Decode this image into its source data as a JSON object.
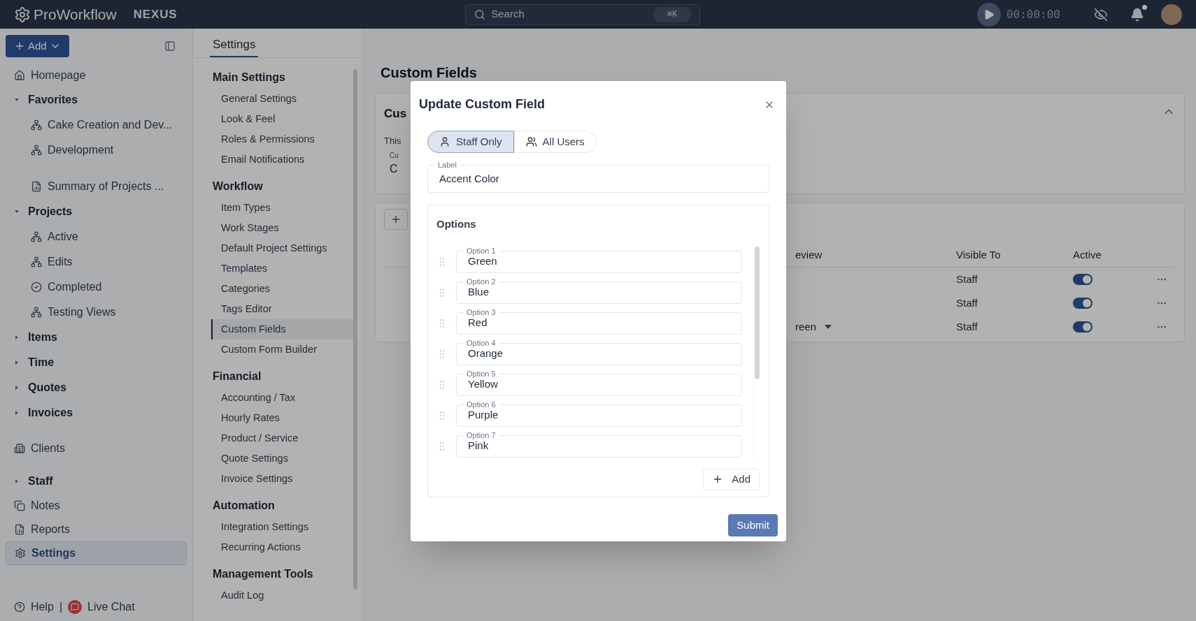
{
  "topbar": {
    "brand": "ProWorkflow",
    "product": "NEXUS",
    "search": {
      "placeholder": "Search",
      "shortcut": "⌘K"
    },
    "timer": "00:00:00"
  },
  "sidebar": {
    "add_button": "Add",
    "items": [
      {
        "kind": "home",
        "label": "Homepage",
        "selected": false
      },
      {
        "kind": "group",
        "label": "Favorites",
        "expanded": true,
        "children": [
          {
            "kind": "board",
            "label": "Cake Creation and Dev..."
          },
          {
            "kind": "board",
            "label": "Development"
          },
          {
            "kind": "report",
            "label": "Summary of Projects ..."
          }
        ]
      },
      {
        "kind": "group",
        "label": "Projects",
        "expanded": true,
        "children": [
          {
            "kind": "board",
            "label": "Active"
          },
          {
            "kind": "board",
            "label": "Edits"
          },
          {
            "kind": "done",
            "label": "Completed"
          },
          {
            "kind": "board",
            "label": "Testing Views"
          }
        ]
      },
      {
        "kind": "group",
        "label": "Items",
        "expanded": false
      },
      {
        "kind": "group",
        "label": "Time",
        "expanded": false
      },
      {
        "kind": "group",
        "label": "Quotes",
        "expanded": false
      },
      {
        "kind": "group",
        "label": "Invoices",
        "expanded": false
      },
      {
        "kind": "clients",
        "label": "Clients",
        "selected": false
      },
      {
        "kind": "group",
        "label": "Staff",
        "expanded": false
      },
      {
        "kind": "notes",
        "label": "Notes",
        "selected": false
      },
      {
        "kind": "report",
        "label": "Reports",
        "selected": false
      },
      {
        "kind": "settings",
        "label": "Settings",
        "selected": true
      }
    ],
    "help": "Help",
    "separator": "|",
    "chat": "Live Chat"
  },
  "settings_nav": {
    "tab": "Settings",
    "sections": [
      {
        "title": "Main Settings",
        "items": [
          {
            "label": "General Settings",
            "selected": false
          },
          {
            "label": "Look & Feel",
            "selected": false
          },
          {
            "label": "Roles & Permissions",
            "selected": false
          },
          {
            "label": "Email Notifications",
            "selected": false
          }
        ]
      },
      {
        "title": "Workflow",
        "items": [
          {
            "label": "Item Types",
            "selected": false
          },
          {
            "label": "Work Stages",
            "selected": false
          },
          {
            "label": "Default Project Settings",
            "selected": false
          },
          {
            "label": "Templates",
            "selected": false
          },
          {
            "label": "Categories",
            "selected": false
          },
          {
            "label": "Tags Editor",
            "selected": false
          },
          {
            "label": "Custom Fields",
            "selected": true
          },
          {
            "label": "Custom Form Builder",
            "selected": false
          }
        ]
      },
      {
        "title": "Financial",
        "items": [
          {
            "label": "Accounting / Tax",
            "selected": false
          },
          {
            "label": "Hourly Rates",
            "selected": false
          },
          {
            "label": "Product / Service",
            "selected": false
          },
          {
            "label": "Quote Settings",
            "selected": false
          },
          {
            "label": "Invoice Settings",
            "selected": false
          }
        ]
      },
      {
        "title": "Automation",
        "items": [
          {
            "label": "Integration Settings",
            "selected": false
          },
          {
            "label": "Recurring Actions",
            "selected": false
          }
        ]
      },
      {
        "title": "Management Tools",
        "items": [
          {
            "label": "Audit Log",
            "selected": false
          }
        ]
      }
    ]
  },
  "content": {
    "heading": "Custom Fields",
    "card": {
      "title": "Cus",
      "text": "This",
      "field_label": "Cu",
      "field_value": "C"
    },
    "table": {
      "columns": [
        "eview",
        "Visible To",
        "Active"
      ],
      "rows": [
        {
          "visible_to": "Staff",
          "active": true
        },
        {
          "visible_to": "Staff",
          "active": true
        },
        {
          "preview": "reen",
          "visible_to": "Staff",
          "active": true
        }
      ]
    }
  },
  "modal": {
    "title": "Update Custom Field",
    "visibility": [
      {
        "kind": "single",
        "label": "Staff Only",
        "selected": true
      },
      {
        "kind": "group",
        "label": "All Users",
        "selected": false
      }
    ],
    "label_field": {
      "label": "Label",
      "value": "Accent Color"
    },
    "options_title": "Options",
    "options": [
      {
        "label": "Option 1",
        "value": "Green"
      },
      {
        "label": "Option 2",
        "value": "Blue"
      },
      {
        "label": "Option 3",
        "value": "Red"
      },
      {
        "label": "Option 4",
        "value": "Orange"
      },
      {
        "label": "Option 5",
        "value": "Yellow"
      },
      {
        "label": "Option 6",
        "value": "Purple"
      },
      {
        "label": "Option 7",
        "value": "Pink"
      }
    ],
    "add_button": "Add",
    "submit_button": "Submit"
  }
}
